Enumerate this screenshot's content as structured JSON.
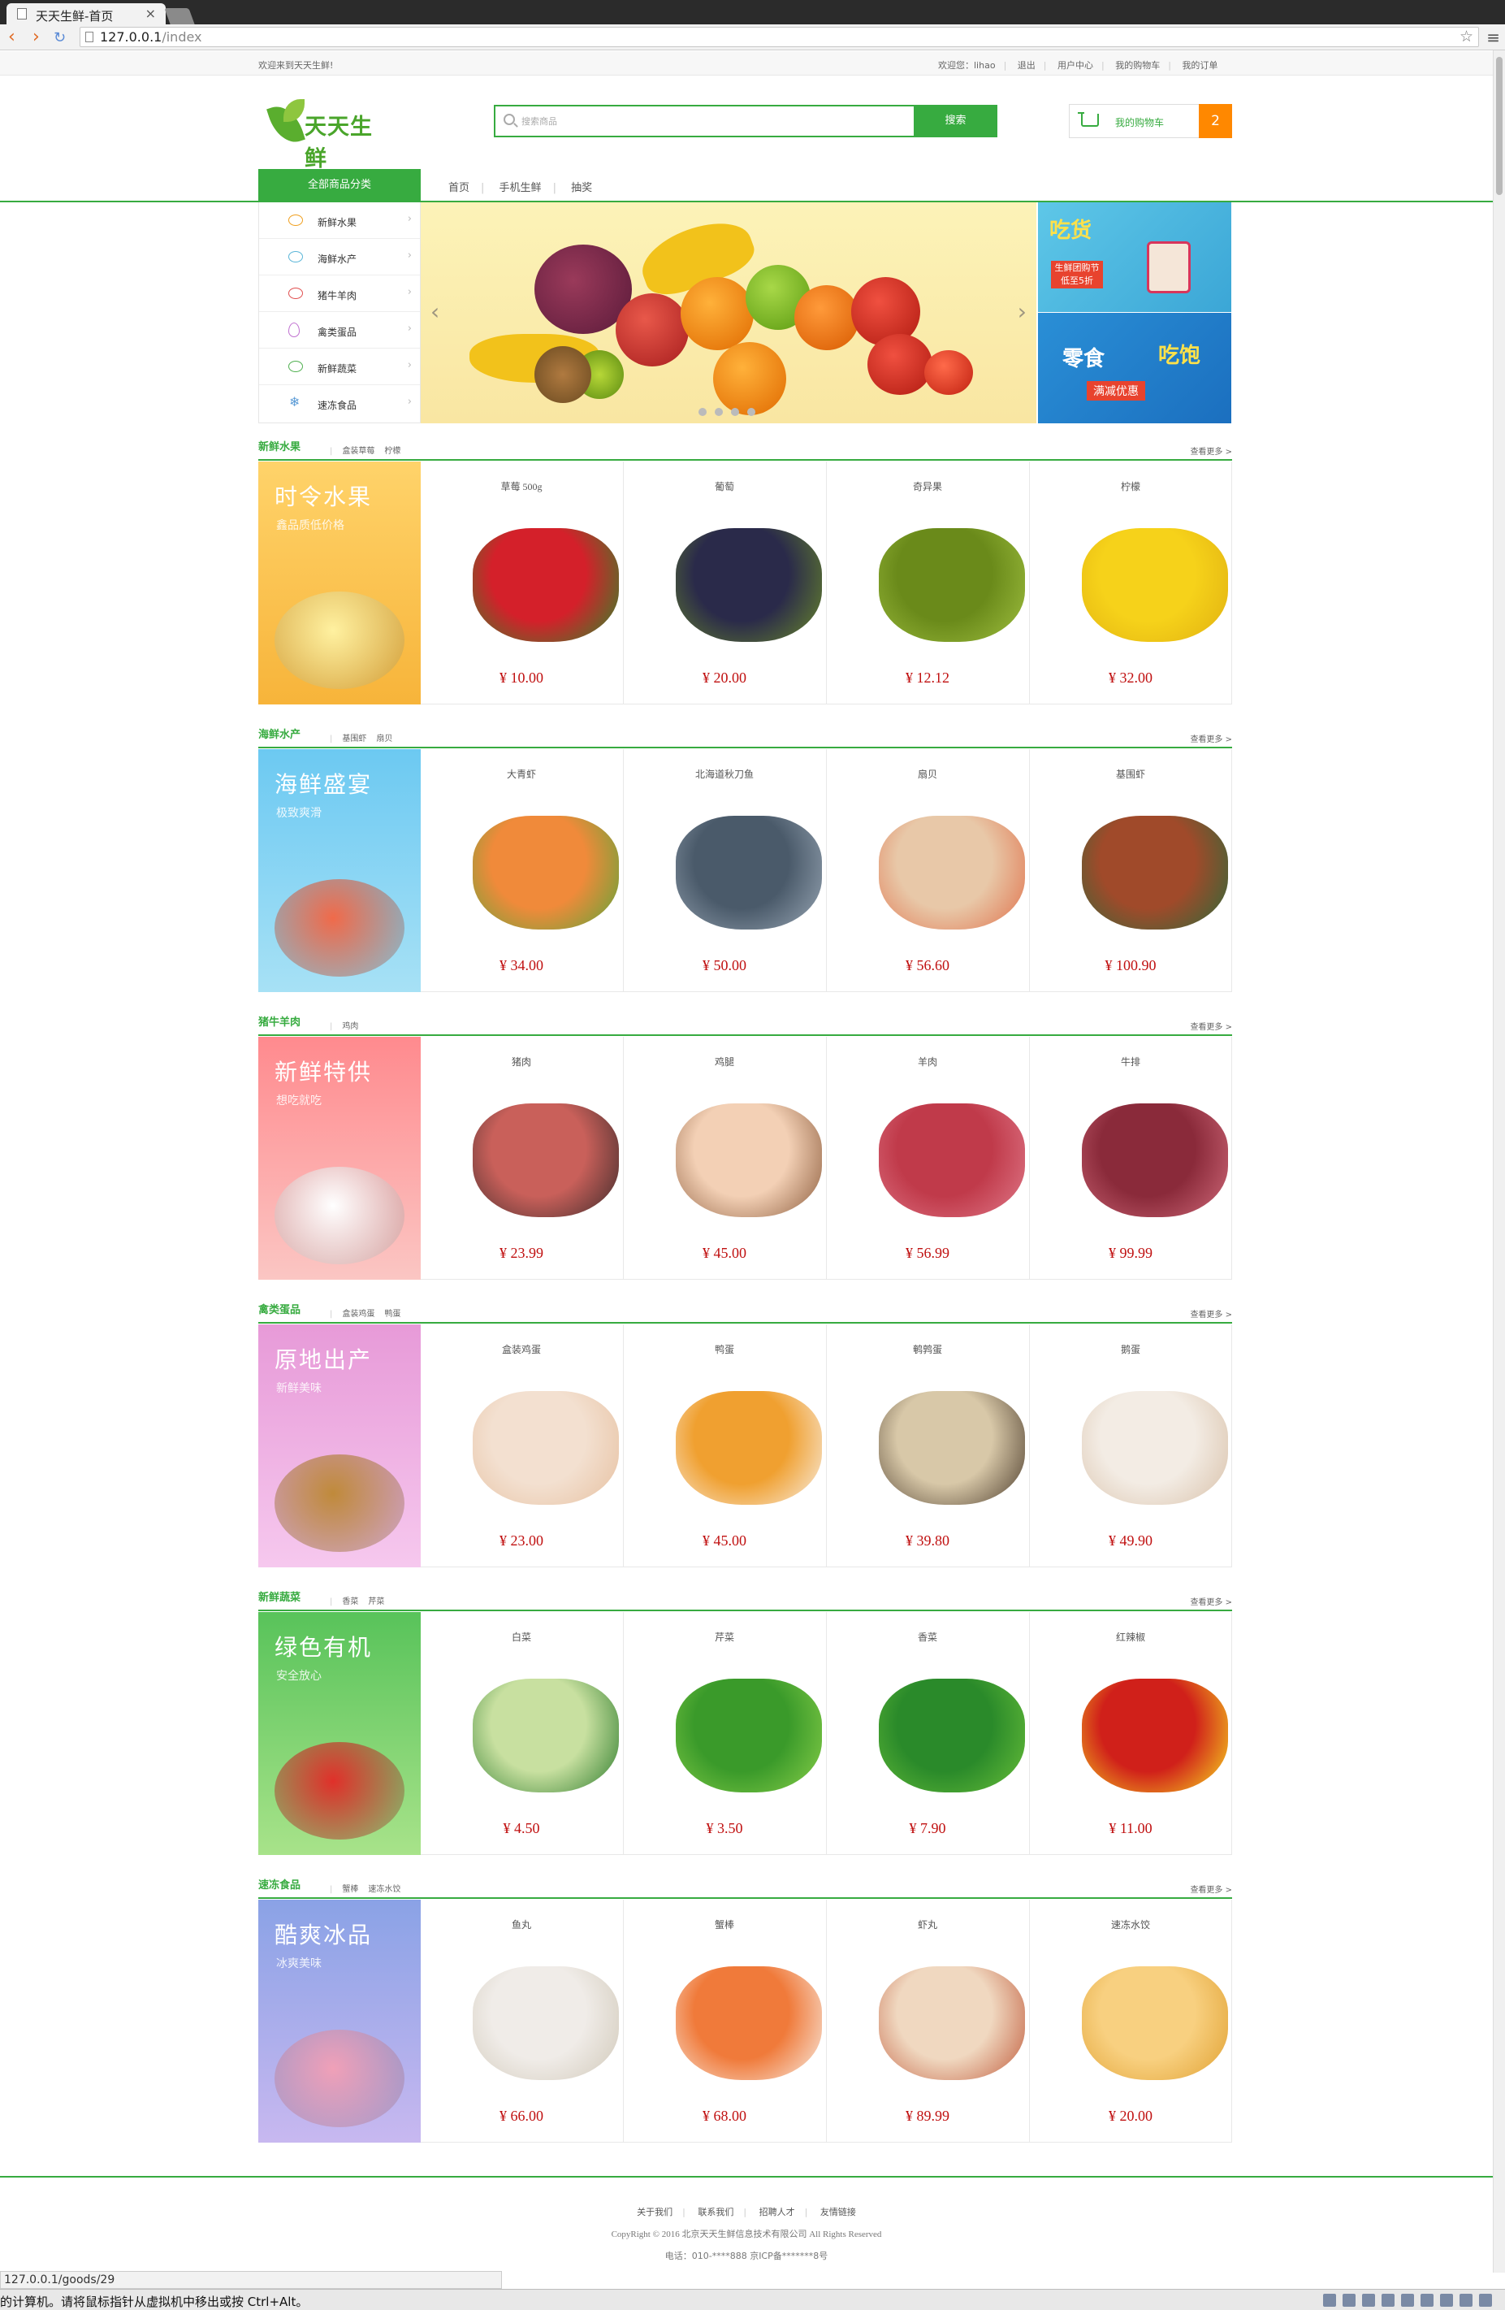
{
  "browser": {
    "tab_title": "天天生鲜-首页",
    "url_host": "127.0.0.1",
    "url_path": "/index",
    "status_url": "127.0.0.1/goods/29"
  },
  "vm_hint": "的计算机。请将鼠标指针从虚拟机中移出或按 Ctrl+Alt。",
  "topbar": {
    "welcome": "欢迎来到天天生鲜!",
    "greeting": "欢迎您：lihao",
    "links": [
      "退出",
      "用户中心",
      "我的购物车",
      "我的订单"
    ]
  },
  "header": {
    "logo_text": "天天生鲜",
    "search_placeholder": "搜索商品",
    "search_button": "搜索",
    "cart_label": "我的购物车",
    "cart_count": "2"
  },
  "nav": {
    "all_categories": "全部商品分类",
    "links": [
      "首页",
      "手机生鲜",
      "抽奖"
    ]
  },
  "categories": [
    "新鲜水果",
    "海鲜水产",
    "猪牛羊肉",
    "禽类蛋品",
    "新鲜蔬菜",
    "速冻食品"
  ],
  "promos": {
    "p1_title": "吃货",
    "p1_tag": "生鲜团购节 低至5折",
    "p2_title": "零食",
    "p2_title2": "吃饱",
    "p2_sub": "满减优惠"
  },
  "more_label": "查看更多 >",
  "floors": [
    {
      "title": "新鲜水果",
      "subs": [
        "盒装草莓",
        "柠檬"
      ],
      "banner_title": "时令水果",
      "banner_sub": "鑫品质低价格",
      "goods": [
        {
          "name": "草莓 500g",
          "price": "¥ 10.00"
        },
        {
          "name": "葡萄",
          "price": "¥ 20.00"
        },
        {
          "name": "奇异果",
          "price": "¥ 12.12"
        },
        {
          "name": "柠檬",
          "price": "¥ 32.00"
        }
      ]
    },
    {
      "title": "海鲜水产",
      "subs": [
        "基围虾",
        "扇贝"
      ],
      "banner_title": "海鲜盛宴",
      "banner_sub": "极致爽滑",
      "goods": [
        {
          "name": "大青虾",
          "price": "¥ 34.00"
        },
        {
          "name": "北海道秋刀鱼",
          "price": "¥ 50.00"
        },
        {
          "name": "扇贝",
          "price": "¥ 56.60"
        },
        {
          "name": "基围虾",
          "price": "¥ 100.90"
        }
      ]
    },
    {
      "title": "猪牛羊肉",
      "subs": [
        "鸡肉"
      ],
      "banner_title": "新鲜特供",
      "banner_sub": "想吃就吃",
      "goods": [
        {
          "name": "猪肉",
          "price": "¥ 23.99"
        },
        {
          "name": "鸡腿",
          "price": "¥ 45.00"
        },
        {
          "name": "羊肉",
          "price": "¥ 56.99"
        },
        {
          "name": "牛排",
          "price": "¥ 99.99"
        }
      ]
    },
    {
      "title": "禽类蛋品",
      "subs": [
        "盒装鸡蛋",
        "鸭蛋"
      ],
      "banner_title": "原地出产",
      "banner_sub": "新鲜美味",
      "goods": [
        {
          "name": "盒装鸡蛋",
          "price": "¥ 23.00"
        },
        {
          "name": "鸭蛋",
          "price": "¥ 45.00"
        },
        {
          "name": "鹌鹑蛋",
          "price": "¥ 39.80"
        },
        {
          "name": "鹅蛋",
          "price": "¥ 49.90"
        }
      ]
    },
    {
      "title": "新鲜蔬菜",
      "subs": [
        "香菜",
        "芹菜"
      ],
      "banner_title": "绿色有机",
      "banner_sub": "安全放心",
      "goods": [
        {
          "name": "白菜",
          "price": "¥ 4.50"
        },
        {
          "name": "芹菜",
          "price": "¥ 3.50"
        },
        {
          "name": "香菜",
          "price": "¥ 7.90"
        },
        {
          "name": "红辣椒",
          "price": "¥ 11.00"
        }
      ]
    },
    {
      "title": "速冻食品",
      "subs": [
        "蟹棒",
        "速冻水饺"
      ],
      "banner_title": "酷爽冰品",
      "banner_sub": "冰爽美味",
      "goods": [
        {
          "name": "鱼丸",
          "price": "¥ 66.00"
        },
        {
          "name": "蟹棒",
          "price": "¥ 68.00"
        },
        {
          "name": "虾丸",
          "price": "¥ 89.99"
        },
        {
          "name": "速冻水饺",
          "price": "¥ 20.00"
        }
      ]
    }
  ],
  "footer": {
    "links": [
      "关于我们",
      "联系我们",
      "招聘人才",
      "友情链接"
    ],
    "copyright": "CopyRight © 2016 北京天天生鲜信息技术有限公司 All Rights Reserved",
    "tel": "电话：010-****888 京ICP备*******8号"
  }
}
